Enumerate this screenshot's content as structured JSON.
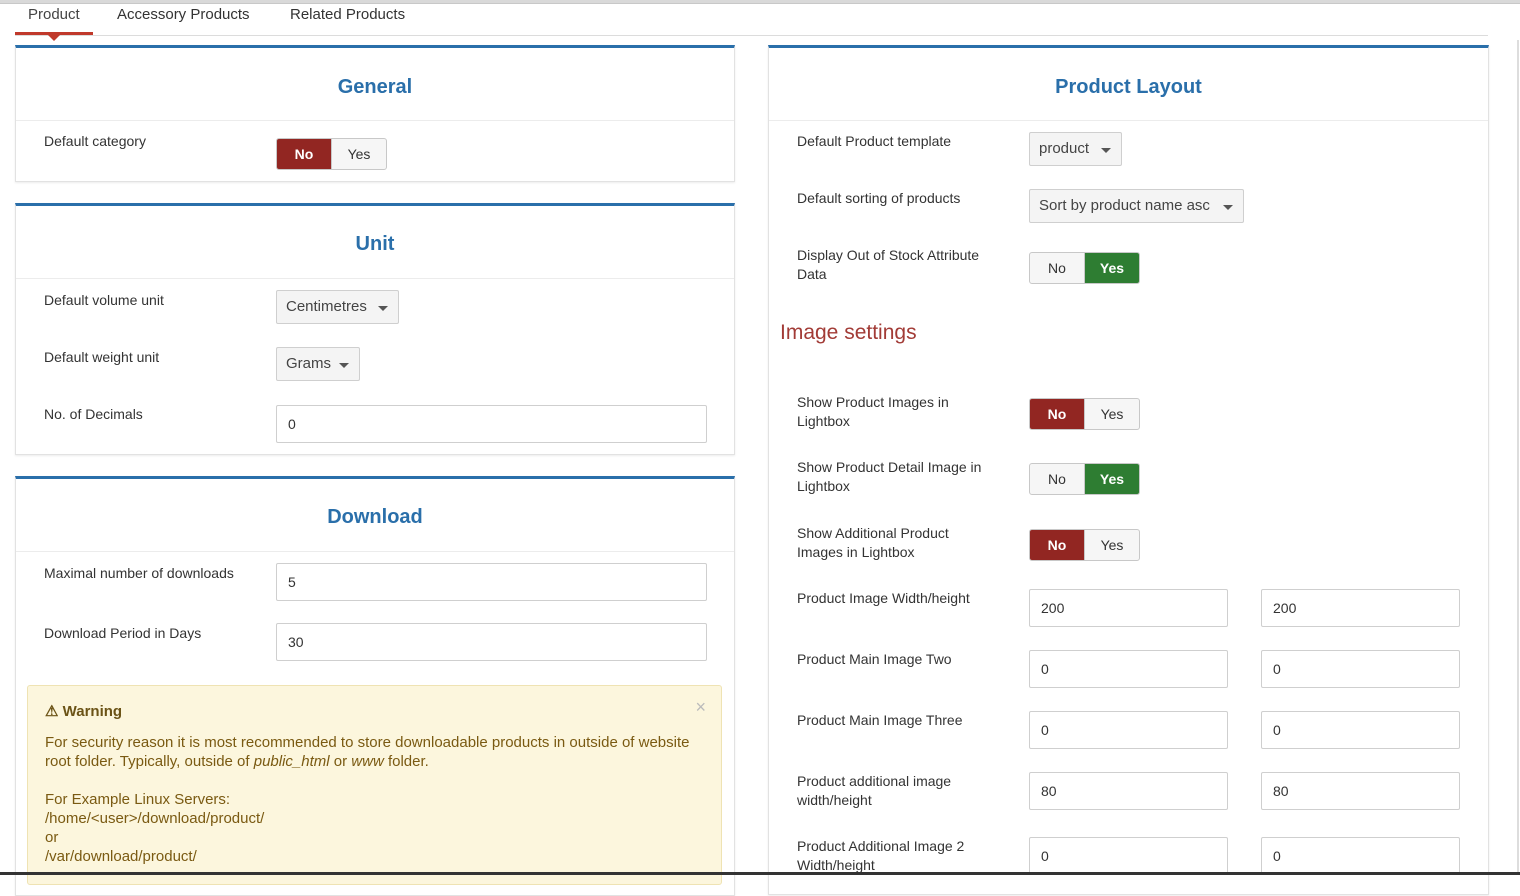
{
  "tabs": [
    "Product",
    "Accessory Products",
    "Related Products"
  ],
  "general": {
    "title": "General",
    "default_category_label": "Default category",
    "default_category": {
      "no": "No",
      "yes": "Yes",
      "selected": "No"
    }
  },
  "unit": {
    "title": "Unit",
    "volume_label": "Default volume unit",
    "volume_value": "Centimetres",
    "weight_label": "Default weight unit",
    "weight_value": "Grams",
    "decimals_label": "No. of Decimals",
    "decimals_value": "0"
  },
  "download": {
    "title": "Download",
    "max_label": "Maximal number of downloads",
    "max_value": "5",
    "period_label": "Download Period in Days",
    "period_value": "30",
    "warning_title": "Warning",
    "warning_close": "×",
    "warning_line1_a": "For security reason it is most recommended to store downloadable products in outside of website root folder. Typically, outside of ",
    "warning_line1_em1": "public_html",
    "warning_line1_b": " or ",
    "warning_line1_em2": "www",
    "warning_line1_c": " folder.",
    "warning_example": "For Example Linux Servers:",
    "warning_path1": "/home/<user>/download/product/",
    "warning_or": "or",
    "warning_path2": "/var/download/product/"
  },
  "layout": {
    "title": "Product Layout",
    "template_label": "Default Product template",
    "template_value": "product",
    "sorting_label": "Default sorting of products",
    "sorting_value": "Sort by product name asc",
    "oos_label": "Display Out of Stock Attribute Data",
    "oos": {
      "no": "No",
      "yes": "Yes",
      "selected": "Yes"
    },
    "image_settings": "Image settings",
    "lightbox_label": "Show Product Images in Lightbox",
    "lightbox": {
      "no": "No",
      "yes": "Yes",
      "selected": "No"
    },
    "detail_lightbox_label": "Show Product Detail Image in Lightbox",
    "detail_lightbox": {
      "no": "No",
      "yes": "Yes",
      "selected": "Yes"
    },
    "additional_lightbox_label": "Show Additional Product Images in Lightbox",
    "additional_lightbox": {
      "no": "No",
      "yes": "Yes",
      "selected": "No"
    },
    "image_wh_label": "Product Image Width/height",
    "image_w": "200",
    "image_h": "200",
    "main_two_label": "Product Main Image Two",
    "main_two_w": "0",
    "main_two_h": "0",
    "main_three_label": "Product Main Image Three",
    "main_three_w": "0",
    "main_three_h": "0",
    "additional_wh_label": "Product additional image width/height",
    "additional_w": "80",
    "additional_h": "80",
    "additional2_label": "Product Additional Image 2 Width/height",
    "additional2_w": "0",
    "additional2_h": "0"
  },
  "colors": {
    "accent_blue": "#2a6faa",
    "active_red": "#922622",
    "active_green": "#2e7d32",
    "tab_red": "#c0392b"
  }
}
